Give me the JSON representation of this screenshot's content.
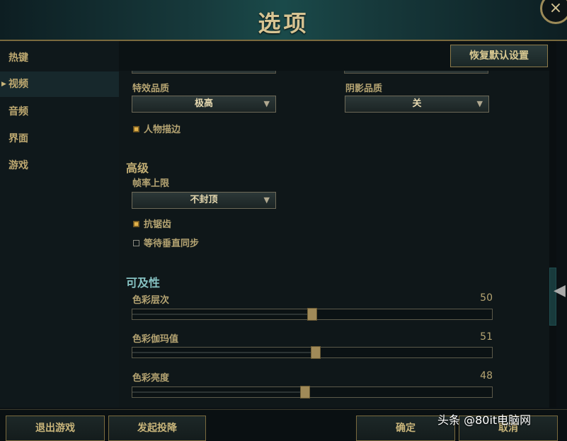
{
  "window": {
    "title": "选项",
    "close_icon": "×"
  },
  "sidebar": {
    "items": [
      {
        "label": "热键"
      },
      {
        "label": "视频",
        "active": true
      },
      {
        "label": "音频"
      },
      {
        "label": "界面"
      },
      {
        "label": "游戏"
      }
    ]
  },
  "toolbar": {
    "reset_label": "恢复默认设置"
  },
  "video": {
    "effects_quality": {
      "label": "特效品质",
      "value": "极高"
    },
    "shadow_quality": {
      "label": "阴影品质",
      "value": "关"
    },
    "character_outline": {
      "label": "人物描边",
      "checked": true
    },
    "advanced": {
      "title": "高级",
      "frame_rate": {
        "label": "帧率上限",
        "value": "不封顶"
      },
      "anti_aliasing": {
        "label": "抗锯齿",
        "checked": true
      },
      "vsync": {
        "label": "等待垂直同步",
        "checked": false
      }
    },
    "accessibility": {
      "title": "可及性",
      "color_levels": {
        "label": "色彩层次",
        "value": "50",
        "fraction": 0.5
      },
      "color_gamma": {
        "label": "色彩伽玛值",
        "value": "51",
        "fraction": 0.51
      },
      "color_brightness": {
        "label": "色彩亮度",
        "value": "48",
        "fraction": 0.48
      }
    }
  },
  "footer": {
    "exit_game": "退出游戏",
    "surrender": "发起投降",
    "confirm": "确定",
    "cancel": "取消"
  },
  "watermark": "头条 @80it电脑网",
  "colors": {
    "accent_gold": "#c9b57a",
    "teal": "#86c2c2",
    "checkbox_on": "#e3b24a"
  }
}
